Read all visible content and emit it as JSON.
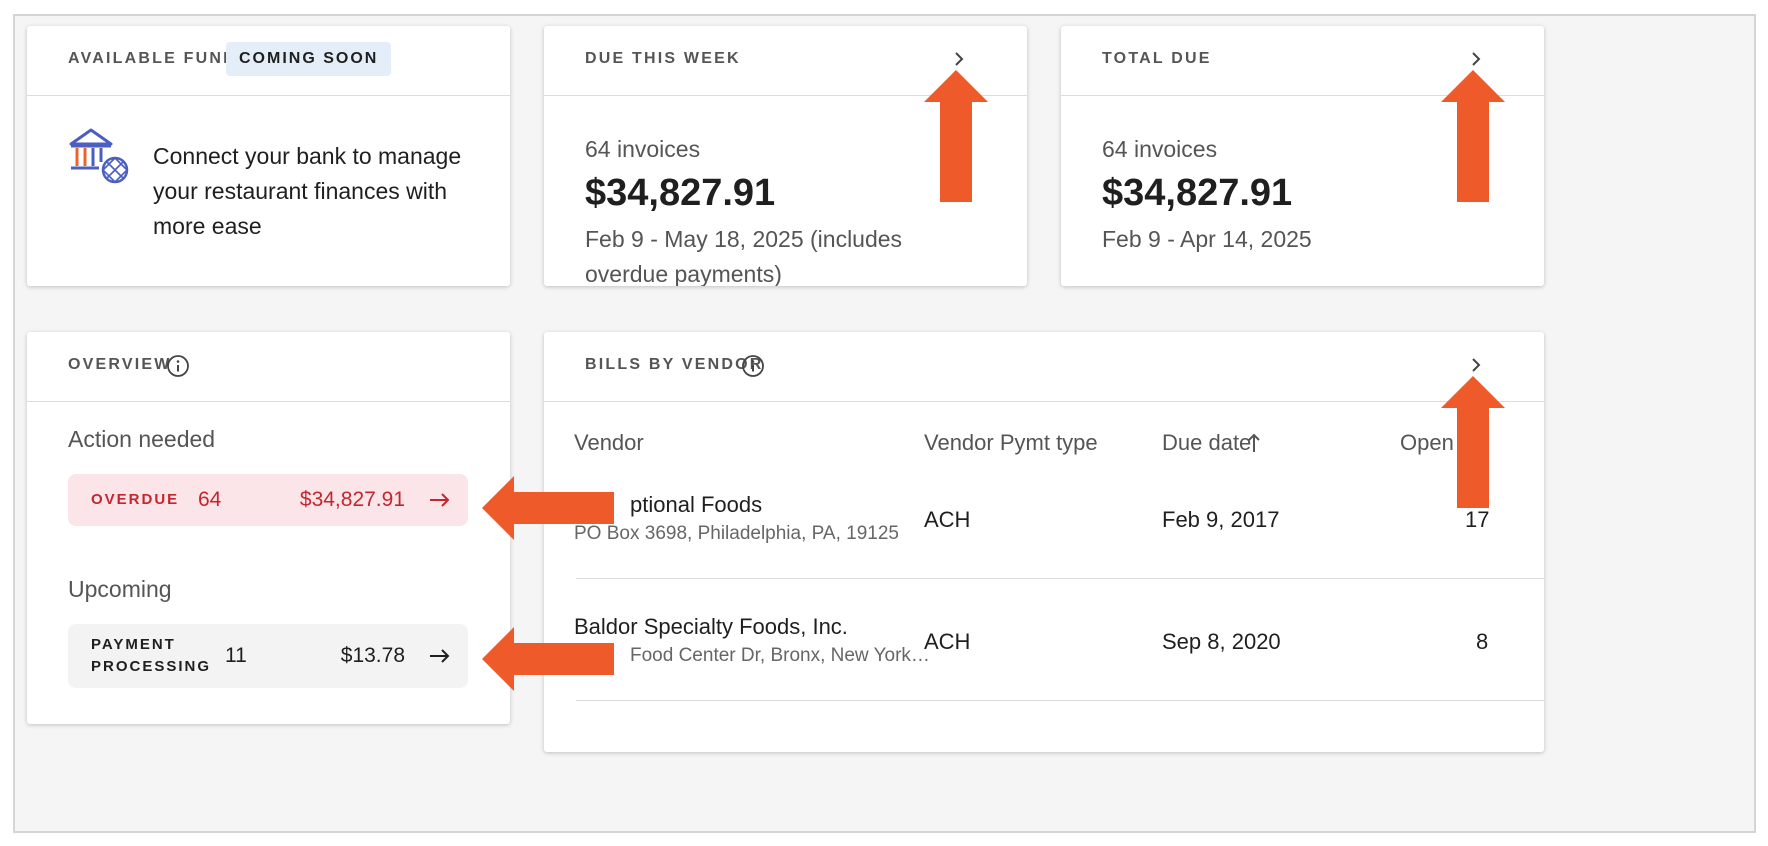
{
  "available_funds": {
    "title": "AVAILABLE FUNDS",
    "badge": "COMING SOON",
    "message": "Connect your bank to manage your restaurant finances with more ease"
  },
  "due_this_week": {
    "title": "DUE THIS WEEK",
    "count": "64 invoices",
    "amount": "$34,827.91",
    "range": "Feb 9 - May 18, 2025 (includes overdue payments)"
  },
  "total_due": {
    "title": "TOTAL DUE",
    "count": "64 invoices",
    "amount": "$34,827.91",
    "range": "Feb 9 - Apr 14, 2025"
  },
  "overview": {
    "title": "OVERVIEW",
    "action_needed_label": "Action needed",
    "overdue": {
      "label": "OVERDUE",
      "count": "64",
      "amount": "$34,827.91"
    },
    "upcoming_label": "Upcoming",
    "payment_processing": {
      "label_line1": "PAYMENT",
      "label_line2": "PROCESSING",
      "count": "11",
      "amount": "$13.78"
    }
  },
  "bills_by_vendor": {
    "title": "BILLS BY VENDOR",
    "columns": [
      "Vendor",
      "Vendor Pymt type",
      "Due date",
      "Open b"
    ],
    "rows": [
      {
        "vendor": "ptional Foods",
        "address": "PO Box 3698, Philadelphia, PA, 19125",
        "pymt_type": "ACH",
        "due_date": "Feb 9, 2017",
        "open": "17"
      },
      {
        "vendor": "Baldor Specialty Foods, Inc.",
        "address": "Food Center Dr, Bronx, New York…",
        "pymt_type": "ACH",
        "due_date": "Sep 8, 2020",
        "open": "8"
      }
    ]
  },
  "colors": {
    "overdue_bg": "#fbe5e8",
    "overdue_text": "#c4262e",
    "processing_bg": "#f3f3f3",
    "badge_bg": "#e4eef8",
    "bank_icon_blue": "#4a5fc1",
    "bank_icon_orange": "#e8642c",
    "callout_arrow": "#ee5a29"
  },
  "icons": [
    "bank-icon",
    "chevron-right-icon",
    "info-icon",
    "arrow-right-icon",
    "sort-ascending-icon"
  ]
}
